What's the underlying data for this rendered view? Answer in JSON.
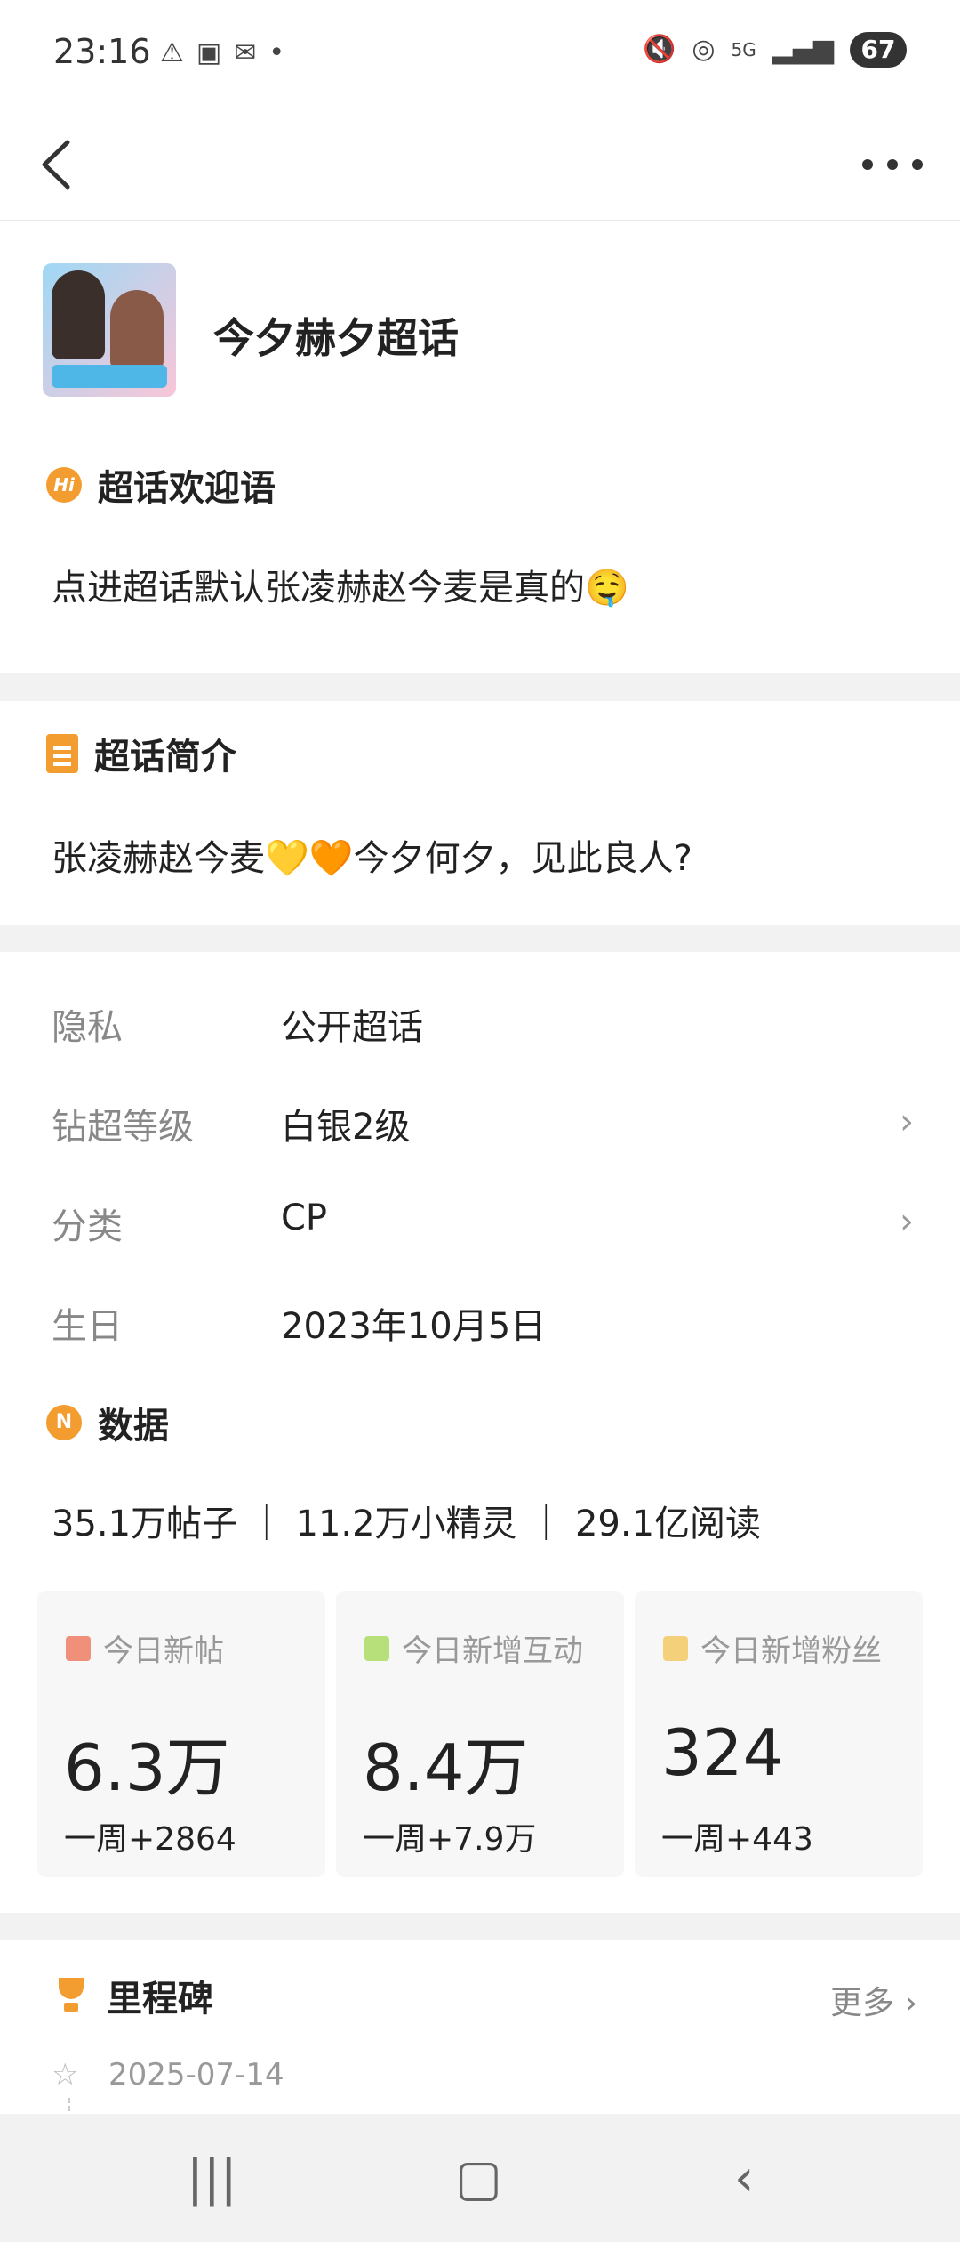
{
  "status": {
    "time": "23:16",
    "network": "5G",
    "battery": "67"
  },
  "topic": {
    "title": "今夕赫夕超话"
  },
  "welcome": {
    "heading": "超话欢迎语",
    "text": "点进超话默认张凌赫赵今麦是真的🤤"
  },
  "intro": {
    "heading": "超话简介",
    "text": "张凌赫赵今麦💛🧡今夕何夕，见此良人?"
  },
  "info": [
    {
      "label": "隐私",
      "value": "公开超话"
    },
    {
      "label": "钻超等级",
      "value": "白银2级"
    },
    {
      "label": "分类",
      "value": "CP"
    },
    {
      "label": "生日",
      "value": "2023年10月5日"
    }
  ],
  "data_section": {
    "heading": "数据",
    "summary": "35.1万帖子 ｜ 11.2万小精灵 ｜ 29.1亿阅读",
    "cards": [
      {
        "label": "今日新帖",
        "value": "6.3万",
        "delta": "一周+2864",
        "color": "#f0907a"
      },
      {
        "label": "今日新增互动",
        "value": "8.4万",
        "delta": "一周+7.9万",
        "color": "#b8e07a"
      },
      {
        "label": "今日新增粉丝",
        "value": "324",
        "delta": "一周+443",
        "color": "#f5d07a"
      }
    ]
  },
  "milestone": {
    "heading": "里程碑",
    "more": "更多",
    "first_date": "2025-07-14"
  },
  "icons": {
    "accent": "#f39c2f"
  }
}
